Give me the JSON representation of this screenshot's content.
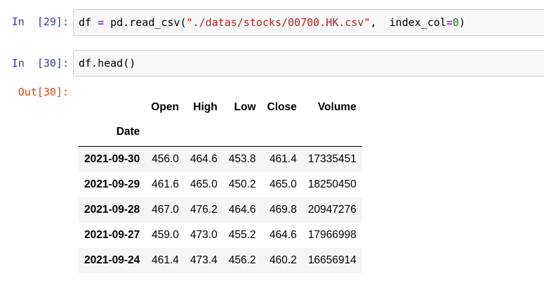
{
  "cells": [
    {
      "prompt": "In  [29]:",
      "code_tokens": [
        {
          "t": "df",
          "c": ""
        },
        {
          "t": " = ",
          "c": "op"
        },
        {
          "t": "pd.read_csv(",
          "c": ""
        },
        {
          "t": "\"./datas/stocks/00700.HK.csv\"",
          "c": "str"
        },
        {
          "t": ",  index_col",
          "c": ""
        },
        {
          "t": "=",
          "c": "op"
        },
        {
          "t": "0",
          "c": "num"
        },
        {
          "t": ")",
          "c": ""
        }
      ]
    },
    {
      "prompt": "In  [30]:",
      "code_tokens": [
        {
          "t": "df.head()",
          "c": ""
        }
      ]
    }
  ],
  "output": {
    "prompt": "Out[30]:",
    "columns": [
      "Open",
      "High",
      "Low",
      "Close",
      "Volume"
    ],
    "index_name": "Date",
    "rows": [
      {
        "date": "2021-09-30",
        "values": [
          "456.0",
          "464.6",
          "453.8",
          "461.4",
          "17335451"
        ]
      },
      {
        "date": "2021-09-29",
        "values": [
          "461.6",
          "465.0",
          "450.2",
          "465.0",
          "18250450"
        ]
      },
      {
        "date": "2021-09-28",
        "values": [
          "467.0",
          "476.2",
          "464.6",
          "469.8",
          "20947276"
        ]
      },
      {
        "date": "2021-09-27",
        "values": [
          "459.0",
          "473.0",
          "455.2",
          "464.6",
          "17966998"
        ]
      },
      {
        "date": "2021-09-24",
        "values": [
          "461.4",
          "473.4",
          "456.2",
          "460.2",
          "16656914"
        ]
      }
    ]
  },
  "colors": {
    "in_prompt": "#303f9f",
    "out_prompt": "#d84315",
    "cell_bg": "#f7f7f7",
    "string": "#ba2121",
    "operator": "#aa22ff",
    "number": "#008000"
  }
}
